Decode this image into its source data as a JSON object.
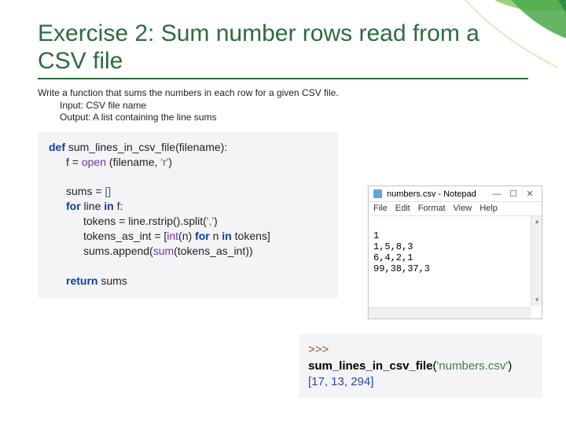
{
  "title": "Exercise 2: Sum number rows read from a CSV file",
  "prompt": {
    "line1": "Write a function that sums the numbers in each row for a given CSV file.",
    "input": "Input: CSV file name",
    "output": "Output:  A list containing the line sums"
  },
  "code": {
    "kw_def": "def",
    "fn_sig": " sum_lines_in_csv_file(filename):",
    "l2a": "f = ",
    "l2_open": "open",
    "l2b": " (filename, ",
    "l2_mode": "'r'",
    "l2c": ")",
    "l3a": "sums = ",
    "l3_lit": "[]",
    "kw_for": "for",
    "l4a": " line ",
    "kw_in": "in",
    "l4b": " f:",
    "l5a": "tokens = line.rstrip().split(",
    "l5_sep": "','",
    "l5b": ")",
    "l6a": "tokens_as_int = [",
    "l6_int": "int",
    "l6b": "(n) ",
    "l6c": " n ",
    "l6d": " tokens]",
    "l7a": "sums.append(",
    "l7_sum": "sum",
    "l7b": "(tokens_as_int))",
    "kw_return": "return",
    "l8a": " sums"
  },
  "notepad": {
    "title": "numbers.csv - Notepad",
    "menu": {
      "file": "File",
      "edit": "Edit",
      "format": "Format",
      "view": "View",
      "help": "Help"
    },
    "lines": {
      "l1": "1",
      "l2": "1,5,8,3",
      "l3": "6,4,2,1",
      "l4": "99,38,37,3"
    },
    "ctrls": {
      "min": "—",
      "max": "☐",
      "close": "✕"
    }
  },
  "repl": {
    "prompt": ">>>",
    "fn": " sum_lines_in_csv_file",
    "open": "(",
    "arg": "'numbers.csv'",
    "close": ")",
    "out": "[17, 13, 294]"
  }
}
